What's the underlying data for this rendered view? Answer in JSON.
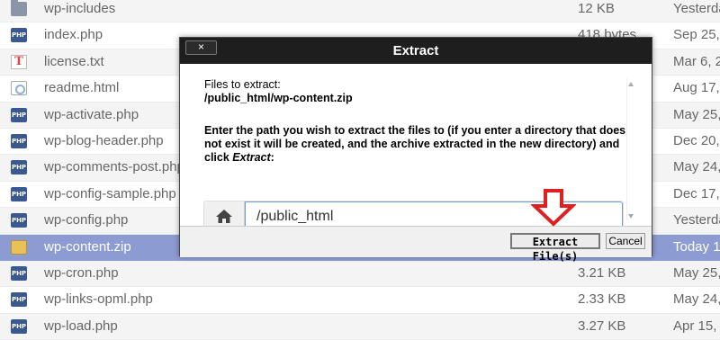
{
  "files": [
    {
      "name": "wp-includes",
      "size": "12 KB",
      "date": "Yesterda",
      "icon": "folder-icon",
      "selected": false
    },
    {
      "name": "index.php",
      "size": "418 bytes",
      "date": "Sep 25,",
      "icon": "php-file-icon",
      "selected": false
    },
    {
      "name": "license.txt",
      "size": "",
      "date": "Mar 6, 2",
      "icon": "text-file-icon",
      "selected": false
    },
    {
      "name": "readme.html",
      "size": "",
      "date": "Aug 17,",
      "icon": "html-file-icon",
      "selected": false
    },
    {
      "name": "wp-activate.php",
      "size": "",
      "date": "May 25,",
      "icon": "php-file-icon",
      "selected": false
    },
    {
      "name": "wp-blog-header.php",
      "size": "",
      "date": "Dec 20,",
      "icon": "php-file-icon",
      "selected": false
    },
    {
      "name": "wp-comments-post.php",
      "size": "",
      "date": "May 24,",
      "icon": "php-file-icon",
      "selected": false
    },
    {
      "name": "wp-config-sample.php",
      "size": "",
      "date": "Dec 17,",
      "icon": "php-file-icon",
      "selected": false
    },
    {
      "name": "wp-config.php",
      "size": "",
      "date": "Yesterda",
      "icon": "php-file-icon",
      "selected": false
    },
    {
      "name": "wp-content.zip",
      "size": "",
      "date": "Today 1",
      "icon": "zip-file-icon",
      "selected": true
    },
    {
      "name": "wp-cron.php",
      "size": "3.21 KB",
      "date": "May 25,",
      "icon": "php-file-icon",
      "selected": false
    },
    {
      "name": "wp-links-opml.php",
      "size": "2.33 KB",
      "date": "May 24,",
      "icon": "php-file-icon",
      "selected": false
    },
    {
      "name": "wp-load.php",
      "size": "3.27 KB",
      "date": "Apr 15,",
      "icon": "php-file-icon",
      "selected": false
    }
  ],
  "dialog": {
    "title": "Extract",
    "close_label": "×",
    "files_label": "Files to extract:",
    "file_path": "/public_html/wp-content.zip",
    "instructions_line1": "Enter the path you wish to extract the files to (if you enter a directory that does",
    "instructions_line2": "not exist it will be created, and the archive extracted in the new directory) and",
    "instructions_line3_prefix": "click ",
    "instructions_line3_em": "Extract",
    "instructions_line3_suffix": ":",
    "path_value": "/public_html",
    "extract_button": "Extract File(s)",
    "cancel_button": "Cancel"
  },
  "colors": {
    "selected_row": "#8d9bd3",
    "title_bar": "#1e1e1e",
    "arrow": "#e02020",
    "input_border": "#6d9fd8"
  }
}
